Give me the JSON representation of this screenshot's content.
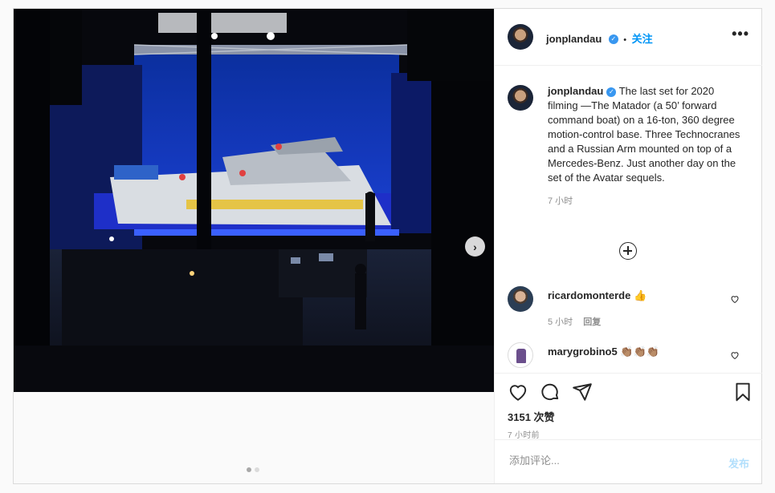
{
  "post": {
    "author": "jonplandau",
    "follow_label": "关注",
    "separator": "•",
    "more_label": "•••",
    "caption": "The last set for 2020 filming —The Matador (a 50’ forward command boat) on a 16-ton, 360 degree motion-control base. Three Technocranes and a Russian Arm mounted on top of a Mercedes-Benz. Just another day on the set of the Avatar sequels.",
    "caption_time": "7 小时",
    "likes": "3151 次赞",
    "post_time": "7 小时前",
    "image_dots": 2,
    "active_dot": 0
  },
  "comments": [
    {
      "user": "ricardomonterde",
      "text": "👍",
      "time": "5 小时",
      "reply": "回复"
    },
    {
      "user": "marygrobino5",
      "text": "👏🏽👏🏽👏🏽"
    }
  ],
  "add_comment": {
    "placeholder": "添加评论...",
    "post_label": "发布"
  },
  "icons": [
    "heart-icon",
    "comment-icon",
    "share-icon",
    "bookmark-icon",
    "chevron-right-icon",
    "verified-icon",
    "more-icon",
    "load-more-icon"
  ],
  "colors": {
    "accent": "#0095f6",
    "verified": "#3897f0",
    "post_disabled": "#b2dffc"
  }
}
